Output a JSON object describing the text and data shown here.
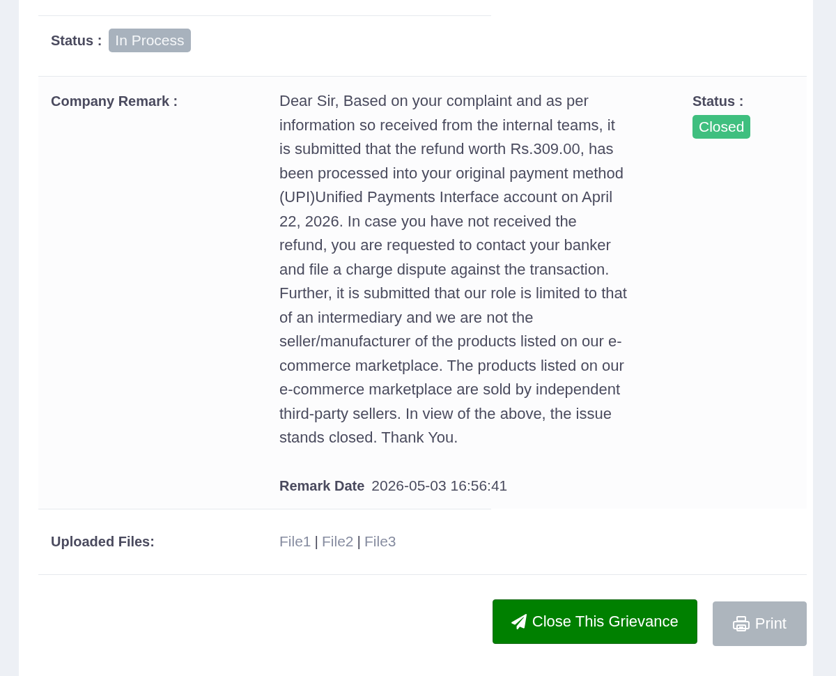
{
  "status_row": {
    "label": "Status :",
    "badge": {
      "text": "In Process",
      "kind": "in_process"
    }
  },
  "remark": {
    "label": "Company Remark :",
    "text": "Dear Sir, Based on your complaint and as per information so received from the internal teams, it is submitted that the refund worth Rs.309.00, has been processed into your original payment method (UPI)Unified Payments Interface account on April 22, 2026. In case you have not received the refund, you are requested to contact your banker and file a charge dispute against the transaction. Further, it is submitted that our role is limited to that of an intermediary and we are not the seller/manufacturer of the products listed on our e-commerce marketplace. The products listed on our e-commerce marketplace are sold by independent third-party sellers. In view of the above, the issue stands closed. Thank You.",
    "date_label": "Remark Date",
    "date": "2026-05-03 16:56:41",
    "status_label": "Status :",
    "status_badge": {
      "text": "Closed",
      "kind": "closed"
    }
  },
  "files": {
    "label": "Uploaded Files:",
    "links": [
      "File1",
      "File2",
      "File3"
    ],
    "separators": [
      "|",
      "|"
    ]
  },
  "buttons": [
    {
      "label": "Close This Grievance",
      "kind": "primary"
    },
    {
      "label": "Print",
      "kind": "secondary"
    }
  ]
}
